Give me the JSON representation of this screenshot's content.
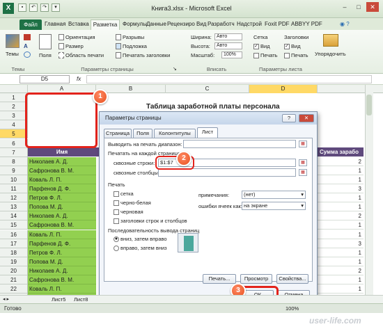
{
  "window": {
    "title": "Книга3.xlsx - Microsoft Excel",
    "controls": [
      "–",
      "□",
      "✕"
    ]
  },
  "ribbon_tabs": {
    "file": "Файл",
    "items": [
      "Главная",
      "Вставка",
      "Разметка с",
      "Формулы",
      "Данные",
      "Рецензиро",
      "Вид",
      "Разработч",
      "Надстрой",
      "Foxit PDF",
      "ABBYY PDF"
    ],
    "active": "Разметка с"
  },
  "ribbon": {
    "themes": "Темы",
    "themes_group": "Темы",
    "margins": "Поля",
    "orientation": "Ориентация",
    "size": "Размер",
    "print_area": "Область печати",
    "breaks": "Разрывы",
    "background": "Подложка",
    "print_titles": "Печатать заголовки",
    "page_setup_group": "Параметры страницы",
    "width_label": "Ширина:",
    "width_value": "Авто",
    "height_label": "Высота:",
    "height_value": "Авто",
    "scale_label": "Масштаб:",
    "scale_value": "100%",
    "fit_group": "Вписать",
    "gridlines": "Сетка",
    "headings": "Заголовки",
    "view_label": "Вид",
    "view_label_2": "Вид",
    "print_label": "Печать",
    "print_label_2": "Печать",
    "sheet_options_group": "Параметры листа",
    "arrange": "Упорядочить"
  },
  "formula_bar": {
    "name_box": "D5",
    "fx": "fx"
  },
  "columns": [
    "A",
    "B",
    "C",
    "D"
  ],
  "column_i_header": "Сумма зарабо",
  "sheet_title": "Таблица заработной платы персонала",
  "header_label": "Имя",
  "row_numbers": [
    "1",
    "2",
    "3",
    "4",
    "5",
    "6",
    "7",
    "8",
    "9",
    "10",
    "11",
    "12",
    "13",
    "14",
    "15",
    "16",
    "17",
    "18",
    "19",
    "20",
    "21",
    "22",
    "23"
  ],
  "names": [
    "Николаев А. Д.",
    "Сафронова В. М.",
    "Коваль Л. П.",
    "Парфенов Д. Ф.",
    "Петров Ф. Л.",
    "Попова М. Д.",
    "Николаев А. Д.",
    "Сафронова В. М.",
    "Коваль Л. П.",
    "Парфенов Д. Ф.",
    "Петров Ф. Л.",
    "Попова М. Д.",
    "Николаев А. Д.",
    "Сафронова В. М.",
    "Коваль Л. П.",
    "Парфенов Д. Ф."
  ],
  "col_i_values": [
    "2",
    "1",
    "1",
    "3",
    "1",
    "1",
    "2",
    "1",
    "1",
    "3",
    "1",
    "1",
    "2",
    "1",
    "1",
    "3"
  ],
  "dialog": {
    "title": "Параметры страницы",
    "help": "?",
    "close": "✕",
    "tabs": [
      "Страница",
      "Поля",
      "Колонтитулы",
      "Лист"
    ],
    "active_tab": "Лист",
    "print_area_label": "Выводить на печать диапазон:",
    "print_titles_label": "Печатать на каждой странице",
    "rows_label": "сквозные строки:",
    "rows_value": "$1:$7",
    "cols_label": "сквозные столбцы:",
    "print_section": "Печать",
    "checks": [
      "сетка",
      "черно-белая",
      "черновая",
      "заголовки строк и столбцов"
    ],
    "comments_label": "примечания:",
    "comments_value": "(нет)",
    "errors_label": "ошибки ячеек как:",
    "errors_value": "на экране",
    "order_section": "Последовательность вывода страниц",
    "order_down": "вниз, затем вправо",
    "order_right": "вправо, затем вниз",
    "btn_print": "Печать...",
    "btn_preview": "Просмотр",
    "btn_options": "Свойства...",
    "btn_ok": "ОК",
    "btn_cancel": "Отмена"
  },
  "markers": [
    "1",
    "2",
    "3"
  ],
  "sheet_tabs": [
    "Лист5",
    "Лист8"
  ],
  "status": {
    "ready": "Готово",
    "zoom": "100%"
  },
  "watermark": "user-life.com",
  "colors": {
    "excel_green": "#1e7145",
    "highlight_green": "#92d050",
    "header_purple": "#5f4a7d",
    "marker_red": "#e3231c"
  }
}
